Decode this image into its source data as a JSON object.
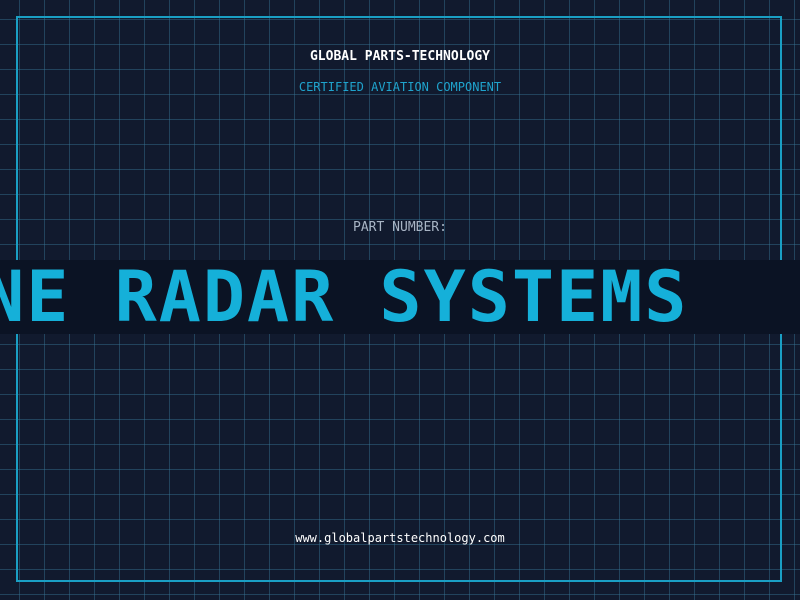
{
  "header": {
    "company": "GLOBAL PARTS-TECHNOLOGY",
    "tagline": "CERTIFIED AVIATION COMPONENT"
  },
  "main": {
    "part_label": "PART NUMBER:",
    "part_number": "INE RADAR SYSTEMS"
  },
  "footer": {
    "url": "www.globalpartstechnology.com"
  },
  "colors": {
    "background": "#111a2e",
    "grid": "#38769a",
    "accent": "#15b0d9",
    "text": "#ffffff",
    "muted": "#a8b4c4"
  }
}
